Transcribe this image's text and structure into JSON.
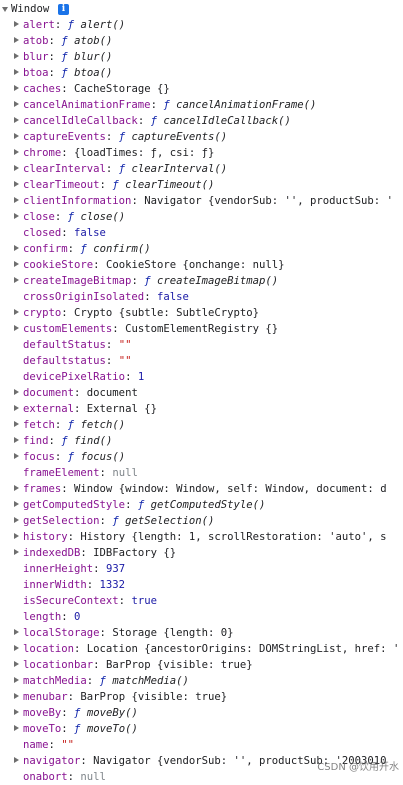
{
  "header": {
    "title": "Window",
    "info_icon": "i"
  },
  "rows": [
    {
      "key": "alert",
      "type": "fn",
      "value": "alert()",
      "expandable": true
    },
    {
      "key": "atob",
      "type": "fn",
      "value": "atob()",
      "expandable": true
    },
    {
      "key": "blur",
      "type": "fn",
      "value": "blur()",
      "expandable": true
    },
    {
      "key": "btoa",
      "type": "fn",
      "value": "btoa()",
      "expandable": true
    },
    {
      "key": "caches",
      "type": "obj",
      "value": "CacheStorage {}",
      "expandable": true
    },
    {
      "key": "cancelAnimationFrame",
      "type": "fn",
      "value": "cancelAnimationFrame()",
      "expandable": true
    },
    {
      "key": "cancelIdleCallback",
      "type": "fn",
      "value": "cancelIdleCallback()",
      "expandable": true
    },
    {
      "key": "captureEvents",
      "type": "fn",
      "value": "captureEvents()",
      "expandable": true
    },
    {
      "key": "chrome",
      "type": "obj",
      "value": "{loadTimes: ƒ, csi: ƒ}",
      "expandable": true
    },
    {
      "key": "clearInterval",
      "type": "fn",
      "value": "clearInterval()",
      "expandable": true
    },
    {
      "key": "clearTimeout",
      "type": "fn",
      "value": "clearTimeout()",
      "expandable": true
    },
    {
      "key": "clientInformation",
      "type": "obj",
      "value": "Navigator {vendorSub: '', productSub: '",
      "expandable": true
    },
    {
      "key": "close",
      "type": "fn",
      "value": "close()",
      "expandable": true
    },
    {
      "key": "closed",
      "type": "bool",
      "value": "false",
      "expandable": false
    },
    {
      "key": "confirm",
      "type": "fn",
      "value": "confirm()",
      "expandable": true
    },
    {
      "key": "cookieStore",
      "type": "obj",
      "value": "CookieStore {onchange: null}",
      "expandable": true
    },
    {
      "key": "createImageBitmap",
      "type": "fn",
      "value": "createImageBitmap()",
      "expandable": true
    },
    {
      "key": "crossOriginIsolated",
      "type": "bool",
      "value": "false",
      "expandable": false
    },
    {
      "key": "crypto",
      "type": "obj",
      "value": "Crypto {subtle: SubtleCrypto}",
      "expandable": true
    },
    {
      "key": "customElements",
      "type": "obj",
      "value": "CustomElementRegistry {}",
      "expandable": true
    },
    {
      "key": "defaultStatus",
      "type": "str",
      "value": "\"\"",
      "expandable": false
    },
    {
      "key": "defaultstatus",
      "type": "str",
      "value": "\"\"",
      "expandable": false
    },
    {
      "key": "devicePixelRatio",
      "type": "num",
      "value": "1",
      "expandable": false
    },
    {
      "key": "document",
      "type": "obj",
      "value": "document",
      "expandable": true
    },
    {
      "key": "external",
      "type": "obj",
      "value": "External {}",
      "expandable": true
    },
    {
      "key": "fetch",
      "type": "fn",
      "value": "fetch()",
      "expandable": true
    },
    {
      "key": "find",
      "type": "fn",
      "value": "find()",
      "expandable": true
    },
    {
      "key": "focus",
      "type": "fn",
      "value": "focus()",
      "expandable": true
    },
    {
      "key": "frameElement",
      "type": "null",
      "value": "null",
      "expandable": false
    },
    {
      "key": "frames",
      "type": "obj",
      "value": "Window {window: Window, self: Window, document: d",
      "expandable": true
    },
    {
      "key": "getComputedStyle",
      "type": "fn",
      "value": "getComputedStyle()",
      "expandable": true
    },
    {
      "key": "getSelection",
      "type": "fn",
      "value": "getSelection()",
      "expandable": true
    },
    {
      "key": "history",
      "type": "obj",
      "value": "History {length: 1, scrollRestoration: 'auto', s",
      "expandable": true
    },
    {
      "key": "indexedDB",
      "type": "obj",
      "value": "IDBFactory {}",
      "expandable": true
    },
    {
      "key": "innerHeight",
      "type": "num",
      "value": "937",
      "expandable": false
    },
    {
      "key": "innerWidth",
      "type": "num",
      "value": "1332",
      "expandable": false
    },
    {
      "key": "isSecureContext",
      "type": "bool",
      "value": "true",
      "expandable": false
    },
    {
      "key": "length",
      "type": "num",
      "value": "0",
      "expandable": false
    },
    {
      "key": "localStorage",
      "type": "obj",
      "value": "Storage {length: 0}",
      "expandable": true
    },
    {
      "key": "location",
      "type": "obj",
      "value": "Location {ancestorOrigins: DOMStringList, href: '",
      "expandable": true
    },
    {
      "key": "locationbar",
      "type": "obj",
      "value": "BarProp {visible: true}",
      "expandable": true
    },
    {
      "key": "matchMedia",
      "type": "fn",
      "value": "matchMedia()",
      "expandable": true
    },
    {
      "key": "menubar",
      "type": "obj",
      "value": "BarProp {visible: true}",
      "expandable": true
    },
    {
      "key": "moveBy",
      "type": "fn",
      "value": "moveBy()",
      "expandable": true
    },
    {
      "key": "moveTo",
      "type": "fn",
      "value": "moveTo()",
      "expandable": true
    },
    {
      "key": "name",
      "type": "str",
      "value": "\"\"",
      "expandable": false
    },
    {
      "key": "navigator",
      "type": "obj",
      "value": "Navigator {vendorSub: '', productSub: '2003010",
      "expandable": true
    },
    {
      "key": "onabort",
      "type": "null",
      "value": "null",
      "expandable": false
    }
  ],
  "fn_prefix": "ƒ",
  "watermark": "CSDN @饮用开水",
  "colors": {
    "key": "#881391",
    "function_prefix": "#0d22aa",
    "string": "#c41a16",
    "number": "#1a1aa6",
    "null": "#80868b",
    "info_badge": "#1a73e8"
  }
}
